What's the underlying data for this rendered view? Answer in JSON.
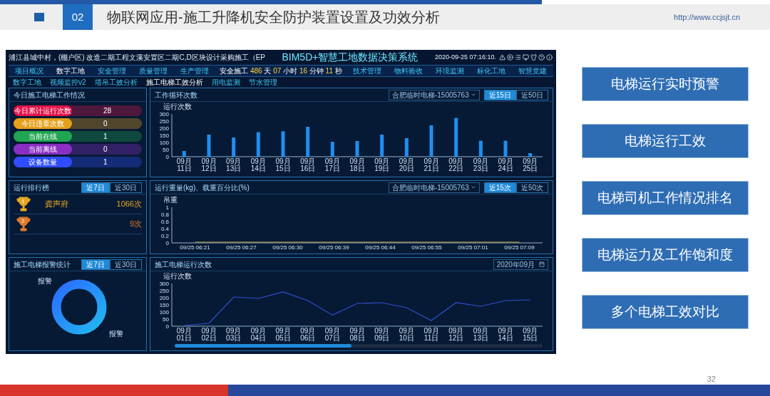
{
  "slide": {
    "number": "02",
    "title": "物联网应用-施工升降机安全防护装置设置及功效分析",
    "url": "http://www.ccjsjt.cn",
    "page": "32"
  },
  "dashboard": {
    "location": "浦江县城中村，(棚户区) 改造二期工程文溪安置区二期C,D区块设计采购施工（EP",
    "title": "BIM5D+智慧工地数据决策系统",
    "datetime": "2020-09-25 07:16:10.",
    "nav_left": [
      {
        "label": "项目概况",
        "selected": false
      },
      {
        "label": "数字工地",
        "selected": true
      },
      {
        "label": "安全管理",
        "selected": false
      },
      {
        "label": "质量管理",
        "selected": false
      },
      {
        "label": "生产管理",
        "selected": false
      }
    ],
    "safety": {
      "prefix": "安全施工",
      "parts": [
        {
          "value": "486",
          "unit": "天"
        },
        {
          "value": "07",
          "unit": "小时"
        },
        {
          "value": "16",
          "unit": "分钟"
        },
        {
          "value": "11",
          "unit": "秒"
        }
      ]
    },
    "nav_right": [
      {
        "label": "技术管理",
        "selected": false
      },
      {
        "label": "物料验收",
        "selected": false
      },
      {
        "label": "环境监测",
        "selected": false
      },
      {
        "label": "标化工地",
        "selected": false
      },
      {
        "label": "智慧党建",
        "selected": false
      }
    ],
    "subnav": [
      {
        "label": "数字工地",
        "selected": false
      },
      {
        "label": "视频监控v2",
        "selected": false
      },
      {
        "label": "塔吊工效分析",
        "selected": false
      },
      {
        "label": "施工电梯工效分析",
        "selected": true
      },
      {
        "label": "用电监测",
        "selected": false
      },
      {
        "label": "节水管理",
        "selected": false
      }
    ],
    "today": {
      "title": "今日施工电梯工作情况",
      "stats": [
        {
          "label": "今日累计运行次数",
          "value": "28",
          "color": "#e3124a"
        },
        {
          "label": "今日违章次数",
          "value": "0",
          "color": "#e6a01c"
        },
        {
          "label": "当前在线",
          "value": "1",
          "color": "#22a552"
        },
        {
          "label": "当前离线",
          "value": "0",
          "color": "#8a2fc4"
        },
        {
          "label": "设备数量",
          "value": "1",
          "color": "#2f4dff"
        }
      ]
    },
    "cycles": {
      "title": "工作循环次数",
      "device": "合肥临时电梯-15005763",
      "ranges": [
        {
          "label": "近15日",
          "selected": true
        },
        {
          "label": "近50日",
          "selected": false
        }
      ],
      "chart_data": {
        "type": "bar",
        "ylabel": "运行次数",
        "categories": [
          "09月11日",
          "09月12日",
          "09月13日",
          "09月14日",
          "09月15日",
          "09月16日",
          "09月17日",
          "09月18日",
          "09月19日",
          "09月20日",
          "09月21日",
          "09月22日",
          "09月23日",
          "09月24日",
          "09月25日"
        ],
        "values": [
          40,
          155,
          135,
          172,
          178,
          210,
          105,
          110,
          155,
          130,
          220,
          272,
          112,
          112,
          25
        ],
        "ylim": [
          0,
          300
        ],
        "yticks": [
          0,
          50,
          100,
          150,
          200,
          250,
          300
        ]
      }
    },
    "ranking": {
      "title": "运行排行榜",
      "ranges": [
        {
          "label": "近7日",
          "selected": true
        },
        {
          "label": "近30日",
          "selected": false
        }
      ],
      "rows": [
        {
          "rank": "1",
          "name": "龚声府",
          "count": "1066次",
          "color": "#e8a623"
        },
        {
          "rank": "2",
          "count": "9次",
          "color": "#e07a2a"
        }
      ]
    },
    "weight": {
      "title": "运行重量(kg)、载重百分比(%)",
      "device": "合肥临时电梯-15005763",
      "ranges": [
        {
          "label": "近15次",
          "selected": true
        },
        {
          "label": "近50次",
          "selected": false
        }
      ],
      "chart_data": {
        "type": "line",
        "ylabel": "吊重",
        "categories": [
          "09/25 06:21",
          "09/25 06:27",
          "09/25 06:30",
          "09/25 06:39",
          "09/25 06:44",
          "09/25 06:55",
          "09/25 07:01",
          "09/25 07:09"
        ],
        "values": [
          0,
          0,
          0,
          0,
          0,
          0,
          0,
          0
        ],
        "ylim": [
          0,
          1
        ],
        "yticks": [
          0,
          0.2,
          0.4,
          0.6,
          0.8,
          1
        ]
      }
    },
    "alarms": {
      "title": "施工电梯报警统计",
      "ranges": [
        {
          "label": "近7日",
          "selected": true
        },
        {
          "label": "近30日",
          "selected": false
        }
      ],
      "labels": [
        "报警",
        "报警"
      ]
    },
    "runs": {
      "title": "施工电梯运行次数",
      "month": "2020年09月",
      "scroll": {
        "level": 0.48
      },
      "chart_data": {
        "type": "line",
        "ylabel": "运行次数",
        "categories": [
          "09月01日",
          "09月02日",
          "09月03日",
          "09月04日",
          "09月05日",
          "09月06日",
          "09月07日",
          "09月08日",
          "09月09日",
          "09月10日",
          "09月11日",
          "09月12日",
          "09月13日",
          "09月14日",
          "09月15日"
        ],
        "values": [
          0,
          20,
          205,
          195,
          240,
          180,
          78,
          160,
          165,
          130,
          40,
          165,
          140,
          180,
          185
        ],
        "ylim": [
          0,
          300
        ],
        "yticks": [
          0,
          50,
          100,
          150,
          200,
          250,
          300
        ]
      }
    }
  },
  "features": [
    "电梯运行实时预警",
    "电梯运行工效",
    "电梯司机工作情况排名",
    "电梯运力及工作饱和度",
    "多个电梯工效对比"
  ]
}
